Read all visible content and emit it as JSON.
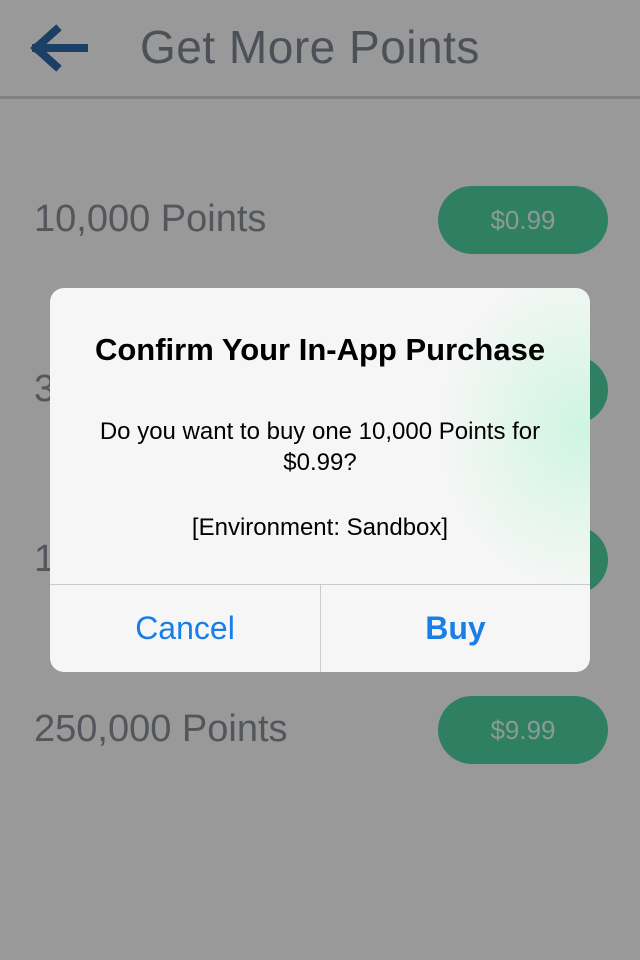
{
  "header": {
    "title": "Get More Points",
    "back_icon": "arrow-left-icon",
    "accent_color": "#2f6aa8"
  },
  "products": [
    {
      "label": "10,000 Points",
      "price": "$0.99"
    },
    {
      "label": "3",
      "price": ""
    },
    {
      "label": "1",
      "price": ""
    },
    {
      "label": "250,000 Points",
      "price": "$9.99"
    }
  ],
  "colors": {
    "price_button": "#4fd5a5",
    "alert_link": "#1a7ee8"
  },
  "dialog": {
    "title": "Confirm Your In-App Purchase",
    "message": "Do you want to buy one 10,000 Points for $0.99?",
    "environment": "[Environment: Sandbox]",
    "cancel_label": "Cancel",
    "buy_label": "Buy"
  }
}
